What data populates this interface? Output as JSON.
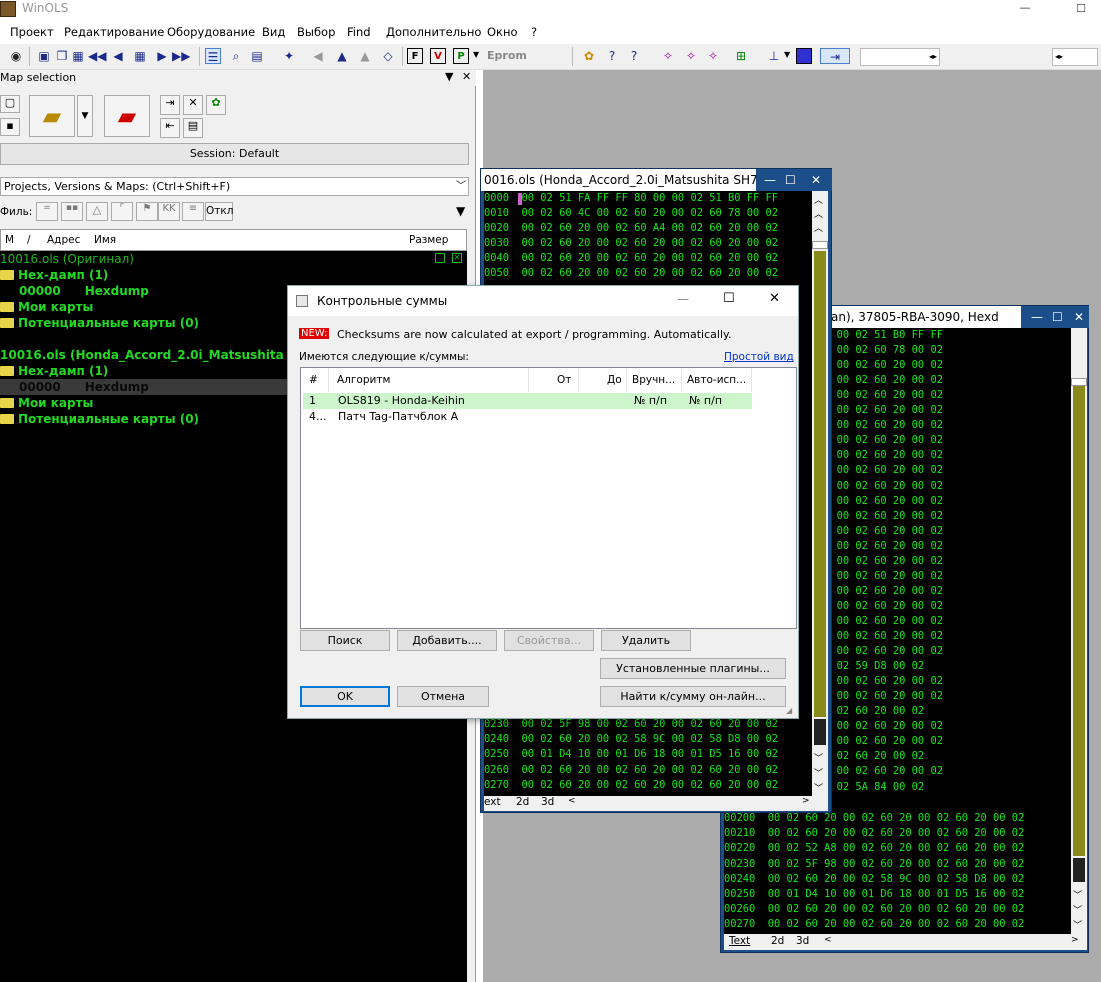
{
  "app": {
    "title": "WinOLS",
    "window_max": "☐"
  },
  "menu": [
    "Проект",
    "Редактирование",
    "Оборудование",
    "Вид",
    "Выбор",
    "Find",
    "Дополнительно",
    "Окно",
    "?"
  ],
  "toolbar": {
    "eprom_label": "Eprom"
  },
  "map_selection": {
    "title": "Map selection",
    "session": "Session: Default",
    "search_placeholder": "Projects, Versions & Maps:  (Ctrl+Shift+F)",
    "filter_label": "Филь:",
    "filter_off": "Откл",
    "columns": [
      "M",
      "/",
      "Адрес",
      "Имя",
      "Размер"
    ],
    "tree": [
      {
        "text": "10016.ols (Оригинал)",
        "kind": "project-original"
      },
      {
        "text": "Hex-дамп (1)",
        "kind": "folder"
      },
      {
        "addr": "00000",
        "name": "Hexdump",
        "kind": "map"
      },
      {
        "text": "Мои карты",
        "kind": "folder"
      },
      {
        "text": "Потенциальные карты (0)",
        "kind": "folder"
      },
      {
        "text": "10016.ols (Honda_Accord_2.0i_Matsushita SH",
        "kind": "project"
      },
      {
        "text": "Hex-дамп (1)",
        "kind": "folder"
      },
      {
        "addr": "00000",
        "name": "Hexdump",
        "kind": "map-selected"
      },
      {
        "text": "Мои карты",
        "kind": "folder"
      },
      {
        "text": "Потенциальные карты (0)",
        "kind": "folder"
      }
    ]
  },
  "hexwin1": {
    "title": "0016.ols (Honda_Accord_2.0i_Matsushita SH7",
    "lines": [
      "0000  00 02 51 FA FF FF 80 00 00 02 51 B0 FF FF",
      "0010  00 02 60 4C 00 02 60 20 00 02 60 78 00 02",
      "0020  00 02 60 20 00 02 60 A4 00 02 60 20 00 02",
      "0030  00 02 60 20 00 02 60 20 00 02 60 20 00 02",
      "0040  00 02 60 20 00 02 60 20 00 02 60 20 00 02",
      "0050  00 02 60 20 00 02 60 20 00 02 60 20 00 02"
    ],
    "lines_bottom": [
      "0230  00 02 5F 98 00 02 60 20 00 02 60 20 00 02",
      "0240  00 02 60 20 00 02 58 9C 00 02 58 D8 00 02",
      "0250  00 01 D4 10 00 01 D6 18 00 01 D5 16 00 02",
      "0260  00 02 60 20 00 02 60 20 00 02 60 20 00 02",
      "0270  00 02 60 20 00 02 60 20 00 02 60 20 00 02"
    ],
    "tabs": [
      "ext",
      "2d",
      "3d"
    ]
  },
  "hexwin2": {
    "title": "an), 37805-RBA-3090, Hexd",
    "lines": [
      "51 FA FF FF 80 00 00 02 51 B0 FF FF",
      "60 4C 00 02 60 20 00 02 60 78 00 02",
      "60 20 00 02 60 A4 00 02 60 20 00 02",
      "60 20 00 02 60 20 00 02 60 20 00 02",
      "60 20 00 02 60 20 00 02 60 20 00 02",
      "60 20 00 02 60 20 00 02 60 20 00 02",
      "60 20 00 02 60 20 00 02 60 20 00 02",
      "60 20 00 02 60 20 00 02 60 20 00 02",
      "60 20 00 02 60 20 00 02 60 20 00 02",
      "60 20 00 02 60 20 00 02 60 20 00 02",
      "60 20 00 02 60 20 00 02 60 20 00 02",
      "60 20 00 02 60 20 00 02 60 20 00 02",
      "60 20 00 02 60 20 00 02 60 20 00 02",
      "60 20 00 02 60 20 00 02 60 20 00 02",
      "60 20 00 02 60 20 00 02 60 20 00 02",
      "60 20 00 02 60 20 00 02 60 20 00 02",
      "60 20 00 02 60 20 00 02 60 20 00 02",
      "60 20 00 02 60 20 00 02 60 20 00 02",
      "60 20 00 02 60 20 00 02 60 20 00 02",
      "60 20 00 02 60 20 00 02 60 20 00 02",
      "60 20 00 02 60 20 00 02 60 20 00 02",
      "60 20 00 02 60 20 00 02 60 20 00 02",
      "94 00 02 60 20 00 02 59 D8 00 02",
      "60 20 00 02 60 20 00 02 60 20 00 02",
      "60 20 00 02 60 20 00 02 60 20 00 02",
      "74 00 02 59 14 00 02 60 20 00 02",
      "60 20 00 02 60 20 00 02 60 20 00 02",
      "60 20 00 02 60 20 00 02 60 20 00 02",
      "78 00 01 D7 DA 00 02 60 20 00 02",
      "60 20 00 02 60 20 00 02 60 20 00 02",
      "34 00 02 5A FE 00 02 5A 84 00 02"
    ],
    "lines_bottom": [
      "00200  00 02 60 20 00 02 60 20 00 02 60 20 00 02",
      "00210  00 02 60 20 00 02 60 20 00 02 60 20 00 02",
      "00220  00 02 52 A8 00 02 60 20 00 02 60 20 00 02",
      "00230  00 02 5F 98 00 02 60 20 00 02 60 20 00 02",
      "00240  00 02 60 20 00 02 58 9C 00 02 58 D8 00 02",
      "00250  00 01 D4 10 00 01 D6 18 00 01 D5 16 00 02",
      "00260  00 02 60 20 00 02 60 20 00 02 60 20 00 02",
      "00270  00 02 60 20 00 02 60 20 00 02 60 20 00 02"
    ],
    "tabs": [
      "Text",
      "2d",
      "3d"
    ]
  },
  "dialog": {
    "title": "Контрольные суммы",
    "new_badge": "NEW:",
    "new_text": "Checksums are now calculated at export / programming. Automatically.",
    "available_label": "Имеются следующие к/суммы:",
    "simple_view_link": "Простой вид",
    "columns": [
      "#",
      "Алгоритм",
      "От",
      "До",
      "Вручн...",
      "Авто-исп..."
    ],
    "rows": [
      {
        "num": "1",
        "algo": "OLS819 - Honda-Keihin",
        "from": "",
        "to": "",
        "manual": "№ п/п",
        "auto": "№ п/п",
        "selected": true
      },
      {
        "num": "4...",
        "algo": "Патч Tag-Патчблок A",
        "from": "",
        "to": "",
        "manual": "",
        "auto": "",
        "selected": false
      }
    ],
    "buttons": {
      "search": "Поиск",
      "add": "Добавить....",
      "properties": "Свойства...",
      "delete": "Удалить",
      "installed_plugins": "Установленные плагины...",
      "ok": "OK",
      "cancel": "Отмена",
      "find_online": "Найти к/сумму он-лайн..."
    }
  },
  "colors": {
    "hex_green": "#19e619",
    "tree_green": "#22d822",
    "window_frame": "#1c4f8a",
    "selected_row": "#ccf5cc",
    "new_badge": "#e00000"
  }
}
